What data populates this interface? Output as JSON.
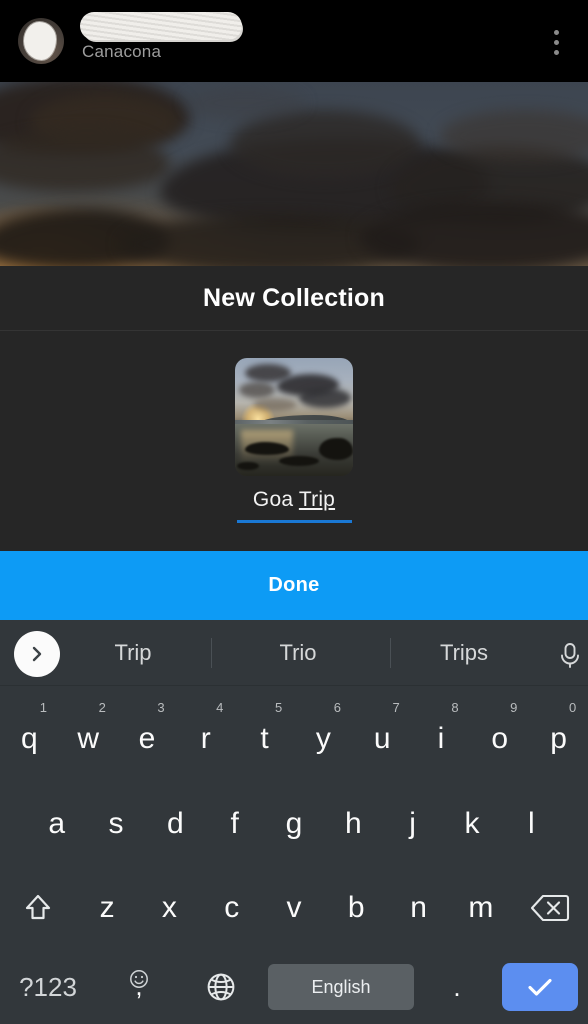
{
  "topbar": {
    "username_redacted": "",
    "location": "Canacona",
    "avatar_name": "user-avatar",
    "menu_icon": "more-vertical-icon"
  },
  "photo": {
    "alt": "dusk sky with dark clouds"
  },
  "dialog": {
    "title": "New Collection",
    "thumbnail_alt": "sunset seascape thumbnail",
    "name_value_prefix": "Goa ",
    "name_value_composing": "Trip",
    "name_value_full": "Goa Trip",
    "underline_color": "#1a78d4"
  },
  "done_button": {
    "label": "Done",
    "color": "#0d9bf5"
  },
  "keyboard": {
    "expand_icon": "chevron-right-icon",
    "mic_icon": "microphone-icon",
    "suggestions": [
      "Trip",
      "Trio",
      "Trips"
    ],
    "row1": [
      {
        "key": "q",
        "num": "1"
      },
      {
        "key": "w",
        "num": "2"
      },
      {
        "key": "e",
        "num": "3"
      },
      {
        "key": "r",
        "num": "4"
      },
      {
        "key": "t",
        "num": "5"
      },
      {
        "key": "y",
        "num": "6"
      },
      {
        "key": "u",
        "num": "7"
      },
      {
        "key": "i",
        "num": "8"
      },
      {
        "key": "o",
        "num": "9"
      },
      {
        "key": "p",
        "num": "0"
      }
    ],
    "row2": [
      "a",
      "s",
      "d",
      "f",
      "g",
      "h",
      "j",
      "k",
      "l"
    ],
    "row3": [
      "z",
      "x",
      "c",
      "v",
      "b",
      "n",
      "m"
    ],
    "shift_icon": "shift-arrow-icon",
    "backspace_icon": "backspace-icon",
    "symbols_label": "?123",
    "comma_label": ",",
    "emoji_icon": "smiley-icon",
    "globe_icon": "globe-language-icon",
    "space_label": "English",
    "period_label": ".",
    "enter_icon": "checkmark-icon",
    "enter_color": "#5c8ef0"
  }
}
